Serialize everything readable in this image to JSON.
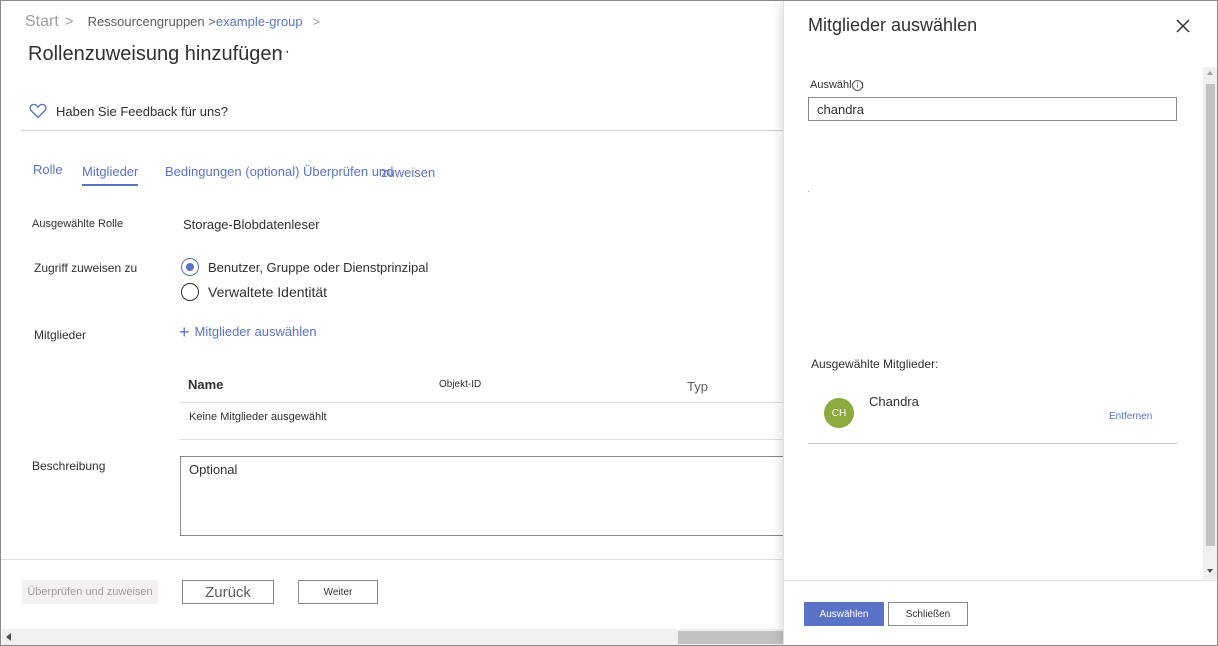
{
  "breadcrumb": {
    "start": "Start",
    "sep": ">",
    "resource_groups": "Ressourcengruppen >",
    "group": "example-group",
    "chevron": ">"
  },
  "page": {
    "title": "Rollenzuweisung hinzufügen",
    "more": "···",
    "feedback": "Haben Sie Feedback für uns?"
  },
  "tabs": {
    "role": "Rolle",
    "members": "Mitglieder",
    "conditions": "Bedingungen (optional) Überprüfen und",
    "assign": "zuweisen",
    "active": "members"
  },
  "form": {
    "selected_role_label": "Ausgewählte Rolle",
    "selected_role_value": "Storage-Blobdatenleser",
    "assign_access_label": "Zugriff zuweisen zu",
    "radio_user": "Benutzer, Gruppe oder Dienstprinzipal",
    "radio_managed": "Verwaltete Identität",
    "members_label": "Mitglieder",
    "add_members": "Mitglieder auswählen",
    "table": {
      "col_name": "Name",
      "col_object_id": "Objekt-ID",
      "col_type": "Typ",
      "empty": "Keine Mitglieder ausgewählt"
    },
    "description_label": "Beschreibung",
    "description_value": "Optional"
  },
  "footer": {
    "review_assign": "Überprüfen und zuweisen",
    "back": "Zurück",
    "next": "Weiter"
  },
  "panel": {
    "title": "Mitglieder auswählen",
    "select_label": "Auswählen",
    "info_icon": "i",
    "search_value": "chandra",
    "selected_members_label": "Ausgewählte Mitglieder:",
    "members": [
      {
        "initials": "CH",
        "name": "Chandra",
        "remove": "Entfernen"
      }
    ],
    "select_button": "Auswählen",
    "close_button": "Schließen"
  },
  "colors": {
    "accent": "#5b73c7",
    "avatar": "#8cab3e"
  }
}
